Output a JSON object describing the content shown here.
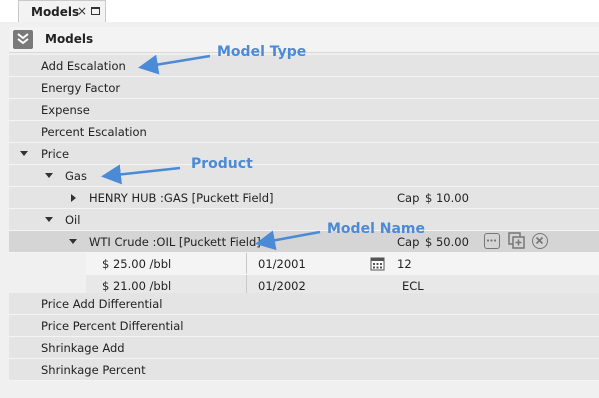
{
  "tab": {
    "title": "Models",
    "close_glyph": "×"
  },
  "panel": {
    "title": "Models"
  },
  "rows": {
    "add_escalation": "Add Escalation",
    "energy_factor": "Energy Factor",
    "expense": "Expense",
    "percent_escalation": "Percent Escalation",
    "price": "Price",
    "gas": "Gas",
    "henry_hub": "HENRY HUB :GAS [Puckett Field]",
    "henry_hub_cap_label": "Cap",
    "henry_hub_cap_value": "$ 10.00",
    "oil": "Oil",
    "wti": "WTI Crude :OIL [Puckett Field]",
    "wti_cap_label": "Cap",
    "wti_cap_value": "$ 50.00",
    "price_add_differential": "Price Add Differential",
    "price_percent_differential": "Price Percent Differential",
    "shrinkage_add": "Shrinkage Add",
    "shrinkage_percent": "Shrinkage Percent"
  },
  "schedule": [
    {
      "price": "$ 25.00 /bbl",
      "date": "01/2001",
      "duration": "12"
    },
    {
      "price": "$ 21.00 /bbl",
      "date": "01/2002",
      "duration": "ECL"
    }
  ],
  "annotations": {
    "model_type": "Model Type",
    "product": "Product",
    "model_name": "Model Name"
  },
  "icons": [
    "chevron-double-down-icon",
    "triangle-down-icon",
    "triangle-right-icon",
    "calendar-icon",
    "ellipsis-icon",
    "duplicate-icon",
    "remove-icon",
    "maximize-icon",
    "close-icon"
  ],
  "colors": {
    "annotation": "#4a8ad6",
    "row": "#e4e4e4",
    "row_selected": "#d5d5d5",
    "header_button": "#7a7a7a"
  }
}
